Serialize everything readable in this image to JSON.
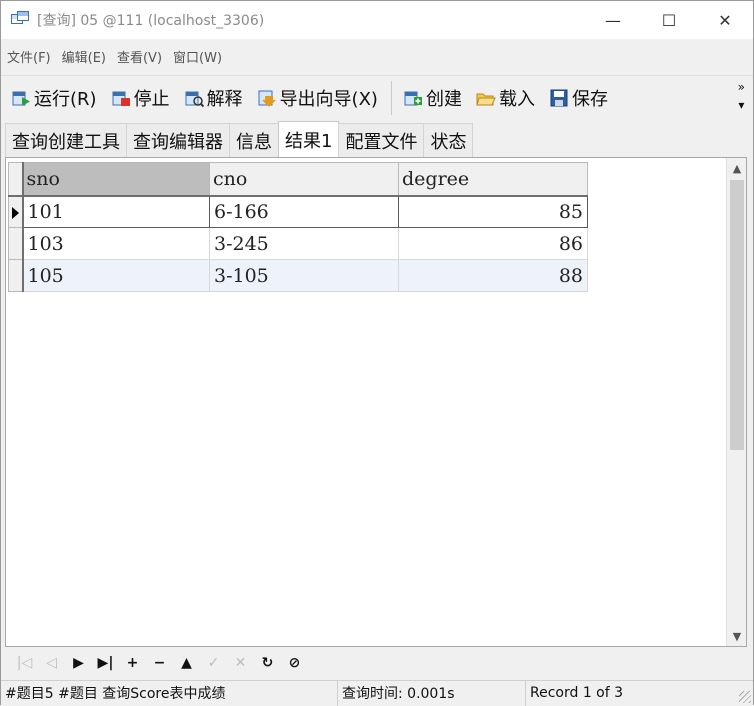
{
  "window": {
    "title": "[查询] 05 @111 (localhost_3306)",
    "controls": [
      "—",
      "☐",
      "✕"
    ]
  },
  "menu": [
    "文件(F)",
    "编辑(E)",
    "查看(V)",
    "窗口(W)"
  ],
  "toolbar": {
    "run": "运行(R)",
    "stop": "停止",
    "explain": "解释",
    "export": "导出向导(X)",
    "create": "创建",
    "load": "载入",
    "save": "保存",
    "more": "»"
  },
  "tabs": [
    "查询创建工具",
    "查询编辑器",
    "信息",
    "结果1",
    "配置文件",
    "状态"
  ],
  "active_tab": "结果1",
  "grid": {
    "columns": [
      "sno",
      "cno",
      "degree"
    ],
    "rows": [
      [
        "101",
        "6-166",
        "85"
      ],
      [
        "103",
        "3-245",
        "86"
      ],
      [
        "105",
        "3-105",
        "88"
      ]
    ]
  },
  "nav": {
    "first": "|◁",
    "prev": "◁",
    "next": "▶",
    "last": "▶|",
    "add": "+",
    "delete": "−",
    "post": "▲",
    "edit": "✓",
    "cancel": "✕",
    "refresh": "↻",
    "stop": "⊘"
  },
  "status": {
    "query": "#题目5 #题目  查询Score表中成绩",
    "time": "查询时间: 0.001s",
    "record": "Record 1 of 3"
  }
}
